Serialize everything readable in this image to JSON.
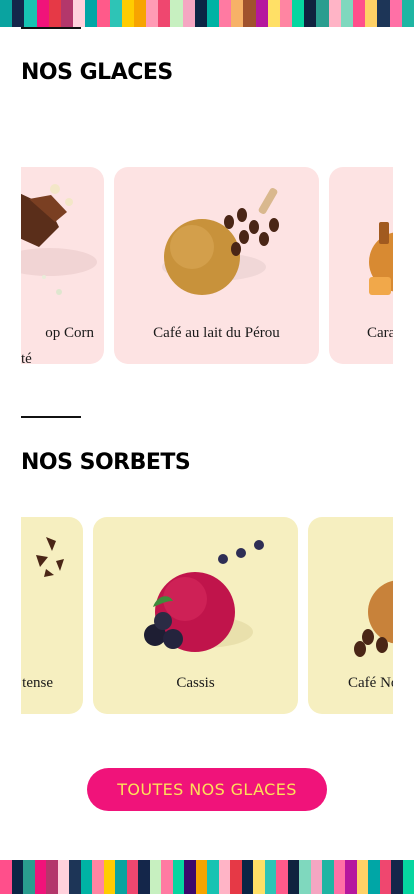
{
  "palette": {
    "stripes_top": [
      "#0aa3a0",
      "#14264a",
      "#17c3b2",
      "#f0137a",
      "#e63946",
      "#b3376b",
      "#ffd1dc",
      "#00a6a6",
      "#ff5a8a",
      "#2ec4b6",
      "#ffcc00",
      "#f7a400",
      "#ff9bb5",
      "#ef476f",
      "#c7f0c0",
      "#f5a6c2",
      "#0b2545",
      "#00b3a4",
      "#ff7aa2",
      "#f7b267",
      "#a0522d",
      "#b5179e",
      "#ffe066",
      "#ff85a2",
      "#06d6a0",
      "#10223f",
      "#2a9d8f",
      "#ffb4c6",
      "#7fd8be",
      "#ff4f8b",
      "#ffd166",
      "#1d3557",
      "#ff70a6",
      "#1fb5a3"
    ],
    "stripes_bottom": [
      "#ff4f8b",
      "#0b2545",
      "#2a9d8f",
      "#f0137a",
      "#b3376b",
      "#ffd1dc",
      "#1d3557",
      "#00b3a4",
      "#ff85a2",
      "#ffcc00",
      "#0aa3a0",
      "#ef476f",
      "#14264a",
      "#c7f0c0",
      "#ff7aa2",
      "#06d6a0",
      "#3c096c",
      "#f7a400",
      "#17c3b2",
      "#ffb4c6",
      "#e63946",
      "#0b2545",
      "#ffe066",
      "#2ec4b6",
      "#ff5a8a",
      "#10223f",
      "#7fd8be",
      "#f5a6c2",
      "#1fb5a3",
      "#ff70a6",
      "#b5179e",
      "#ffd166",
      "#00a6a6",
      "#ef476f",
      "#14264a",
      "#06d6a0"
    ],
    "cta_background": "#f0137a",
    "cta_text": "#fde05a"
  },
  "glaces": {
    "title": "NOS GLACES",
    "cards": [
      {
        "label": "op Corn",
        "sublabel": "té",
        "illustration": "chocolate-popcorn-scoop"
      },
      {
        "label": "Café au lait du Pérou",
        "illustration": "coffee-scoop-with-beans"
      },
      {
        "label": "Cara",
        "illustration": "caramel-scoop"
      }
    ]
  },
  "sorbets": {
    "title": "NOS SORBETS",
    "cards": [
      {
        "label": "tense",
        "illustration": "chocolate-shavings"
      },
      {
        "label": "Cassis",
        "illustration": "blackcurrant-sorbet-scoop"
      },
      {
        "label": "Café No",
        "illustration": "coffee-scoop-with-beans"
      }
    ]
  },
  "cta": {
    "label": "TOUTES NOS GLACES"
  }
}
